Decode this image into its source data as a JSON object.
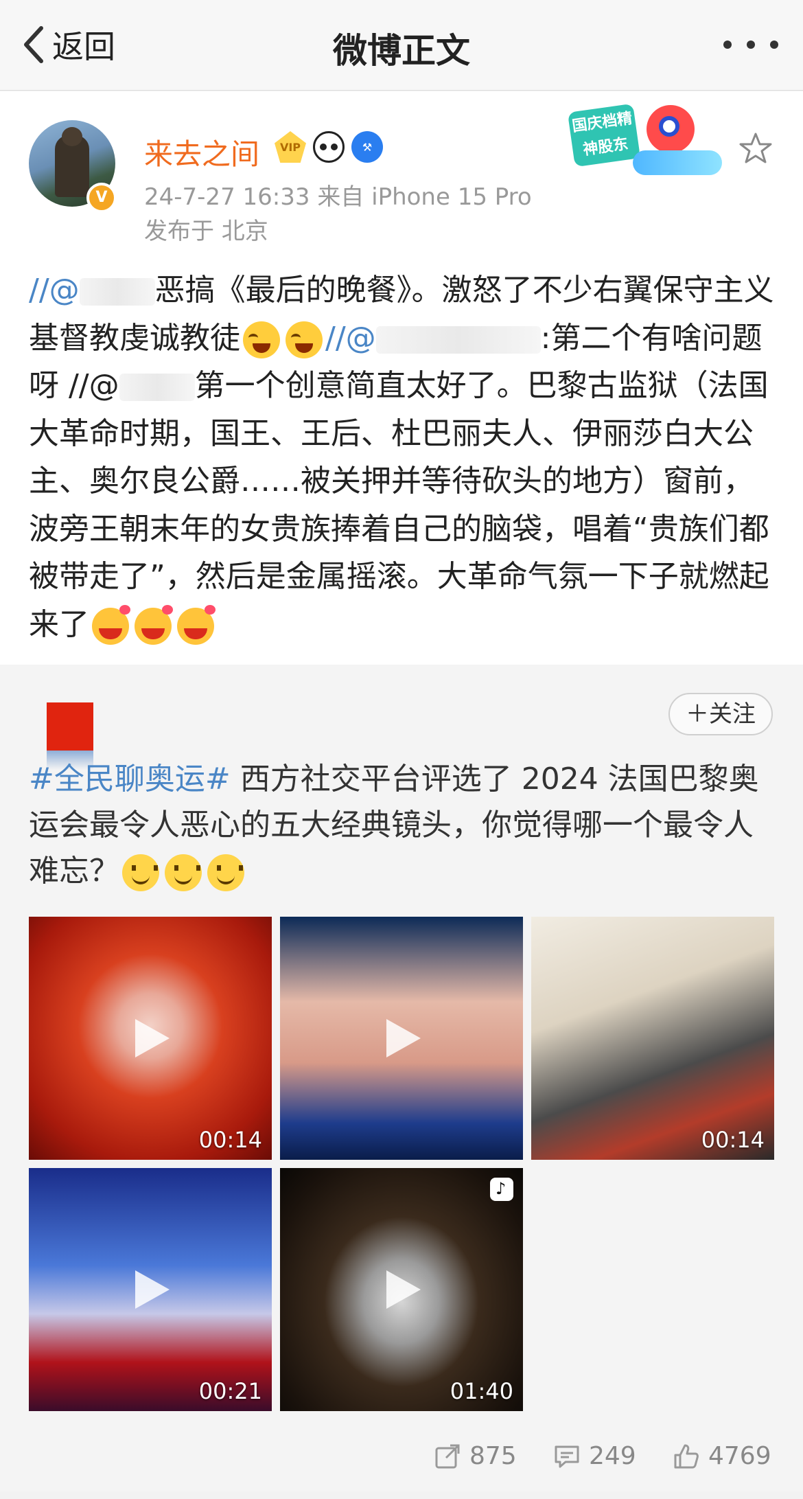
{
  "nav": {
    "back_label": "返回",
    "title": "微博正文"
  },
  "post": {
    "username": "来去之间",
    "vip_badge_text": "VIP",
    "timestamp": "24-7-27 16:33",
    "source": "来自 iPhone 15 Pro",
    "location": "发布于 北京",
    "promo_text": "国庆档精神股东",
    "text": {
      "p1": "//@",
      "p2": "恶搞《最后的晚餐》。激怒了不少右翼保守主义基督教虔诚教徒",
      "p3": "//@",
      "p4": ":第二个有啥问题呀 //@",
      "p5": "第一个创意简直太好了。巴黎古监狱（法国大革命时期，国王、王后、杜巴丽夫人、伊丽莎白大公主、奥尔良公爵……被关押并等待砍头的地方）窗前，波旁王朝末年的女贵族捧着自己的脑袋，唱着“贵族们都被带走了”，然后是金属摇滚。大革命气氛一下子就燃起来了"
    }
  },
  "repost": {
    "follow_label": "＋关注",
    "topic": "#全民聊奥运#",
    "text": " 西方社交平台评选了 2024 法国巴黎奥运会最令人恶心的五大经典镜头，你觉得哪一个最令人难忘？",
    "videos": [
      {
        "duration": "00:14"
      },
      {
        "duration": ""
      },
      {
        "duration": "00:14"
      },
      {
        "duration": "00:21"
      },
      {
        "duration": "01:40"
      }
    ]
  },
  "actions": {
    "shares": "875",
    "comments": "249",
    "likes": "4769"
  },
  "colors": {
    "username": "#f06b1f",
    "link": "#4a86c6",
    "vip_badge": "#f5a623"
  }
}
